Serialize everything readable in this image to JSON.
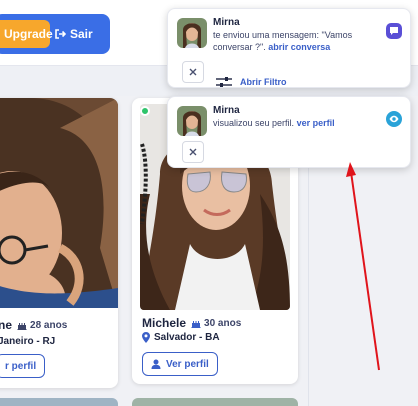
{
  "topbar": {
    "upgrade_label": "Upgrade",
    "logout_label": "Sair"
  },
  "cards": [
    {
      "name": "ne",
      "age": "28 anos",
      "location": "Janeiro - RJ",
      "button_label": "r perfil",
      "online": false
    },
    {
      "name": "Michele",
      "age": "30 anos",
      "location": "Salvador - BA",
      "button_label": "Ver perfil",
      "online": true
    }
  ],
  "notifications": [
    {
      "sender": "Mirna",
      "message": "te enviou uma mensagem: \"Vamos conversar ?\".",
      "link": "abrir conversa",
      "type_icon": "chat-icon"
    },
    {
      "sender": "Mirna",
      "message": "visualizou seu perfil.",
      "link": "ver perfil",
      "type_icon": "eye-icon"
    }
  ],
  "filter": {
    "label": "Abrir Filtro"
  },
  "colors": {
    "primary": "#3a6ee6",
    "upgrade": "#f7a72c",
    "link": "#3a5fc8",
    "online": "#2fc46b",
    "arrow": "#e0141b"
  }
}
